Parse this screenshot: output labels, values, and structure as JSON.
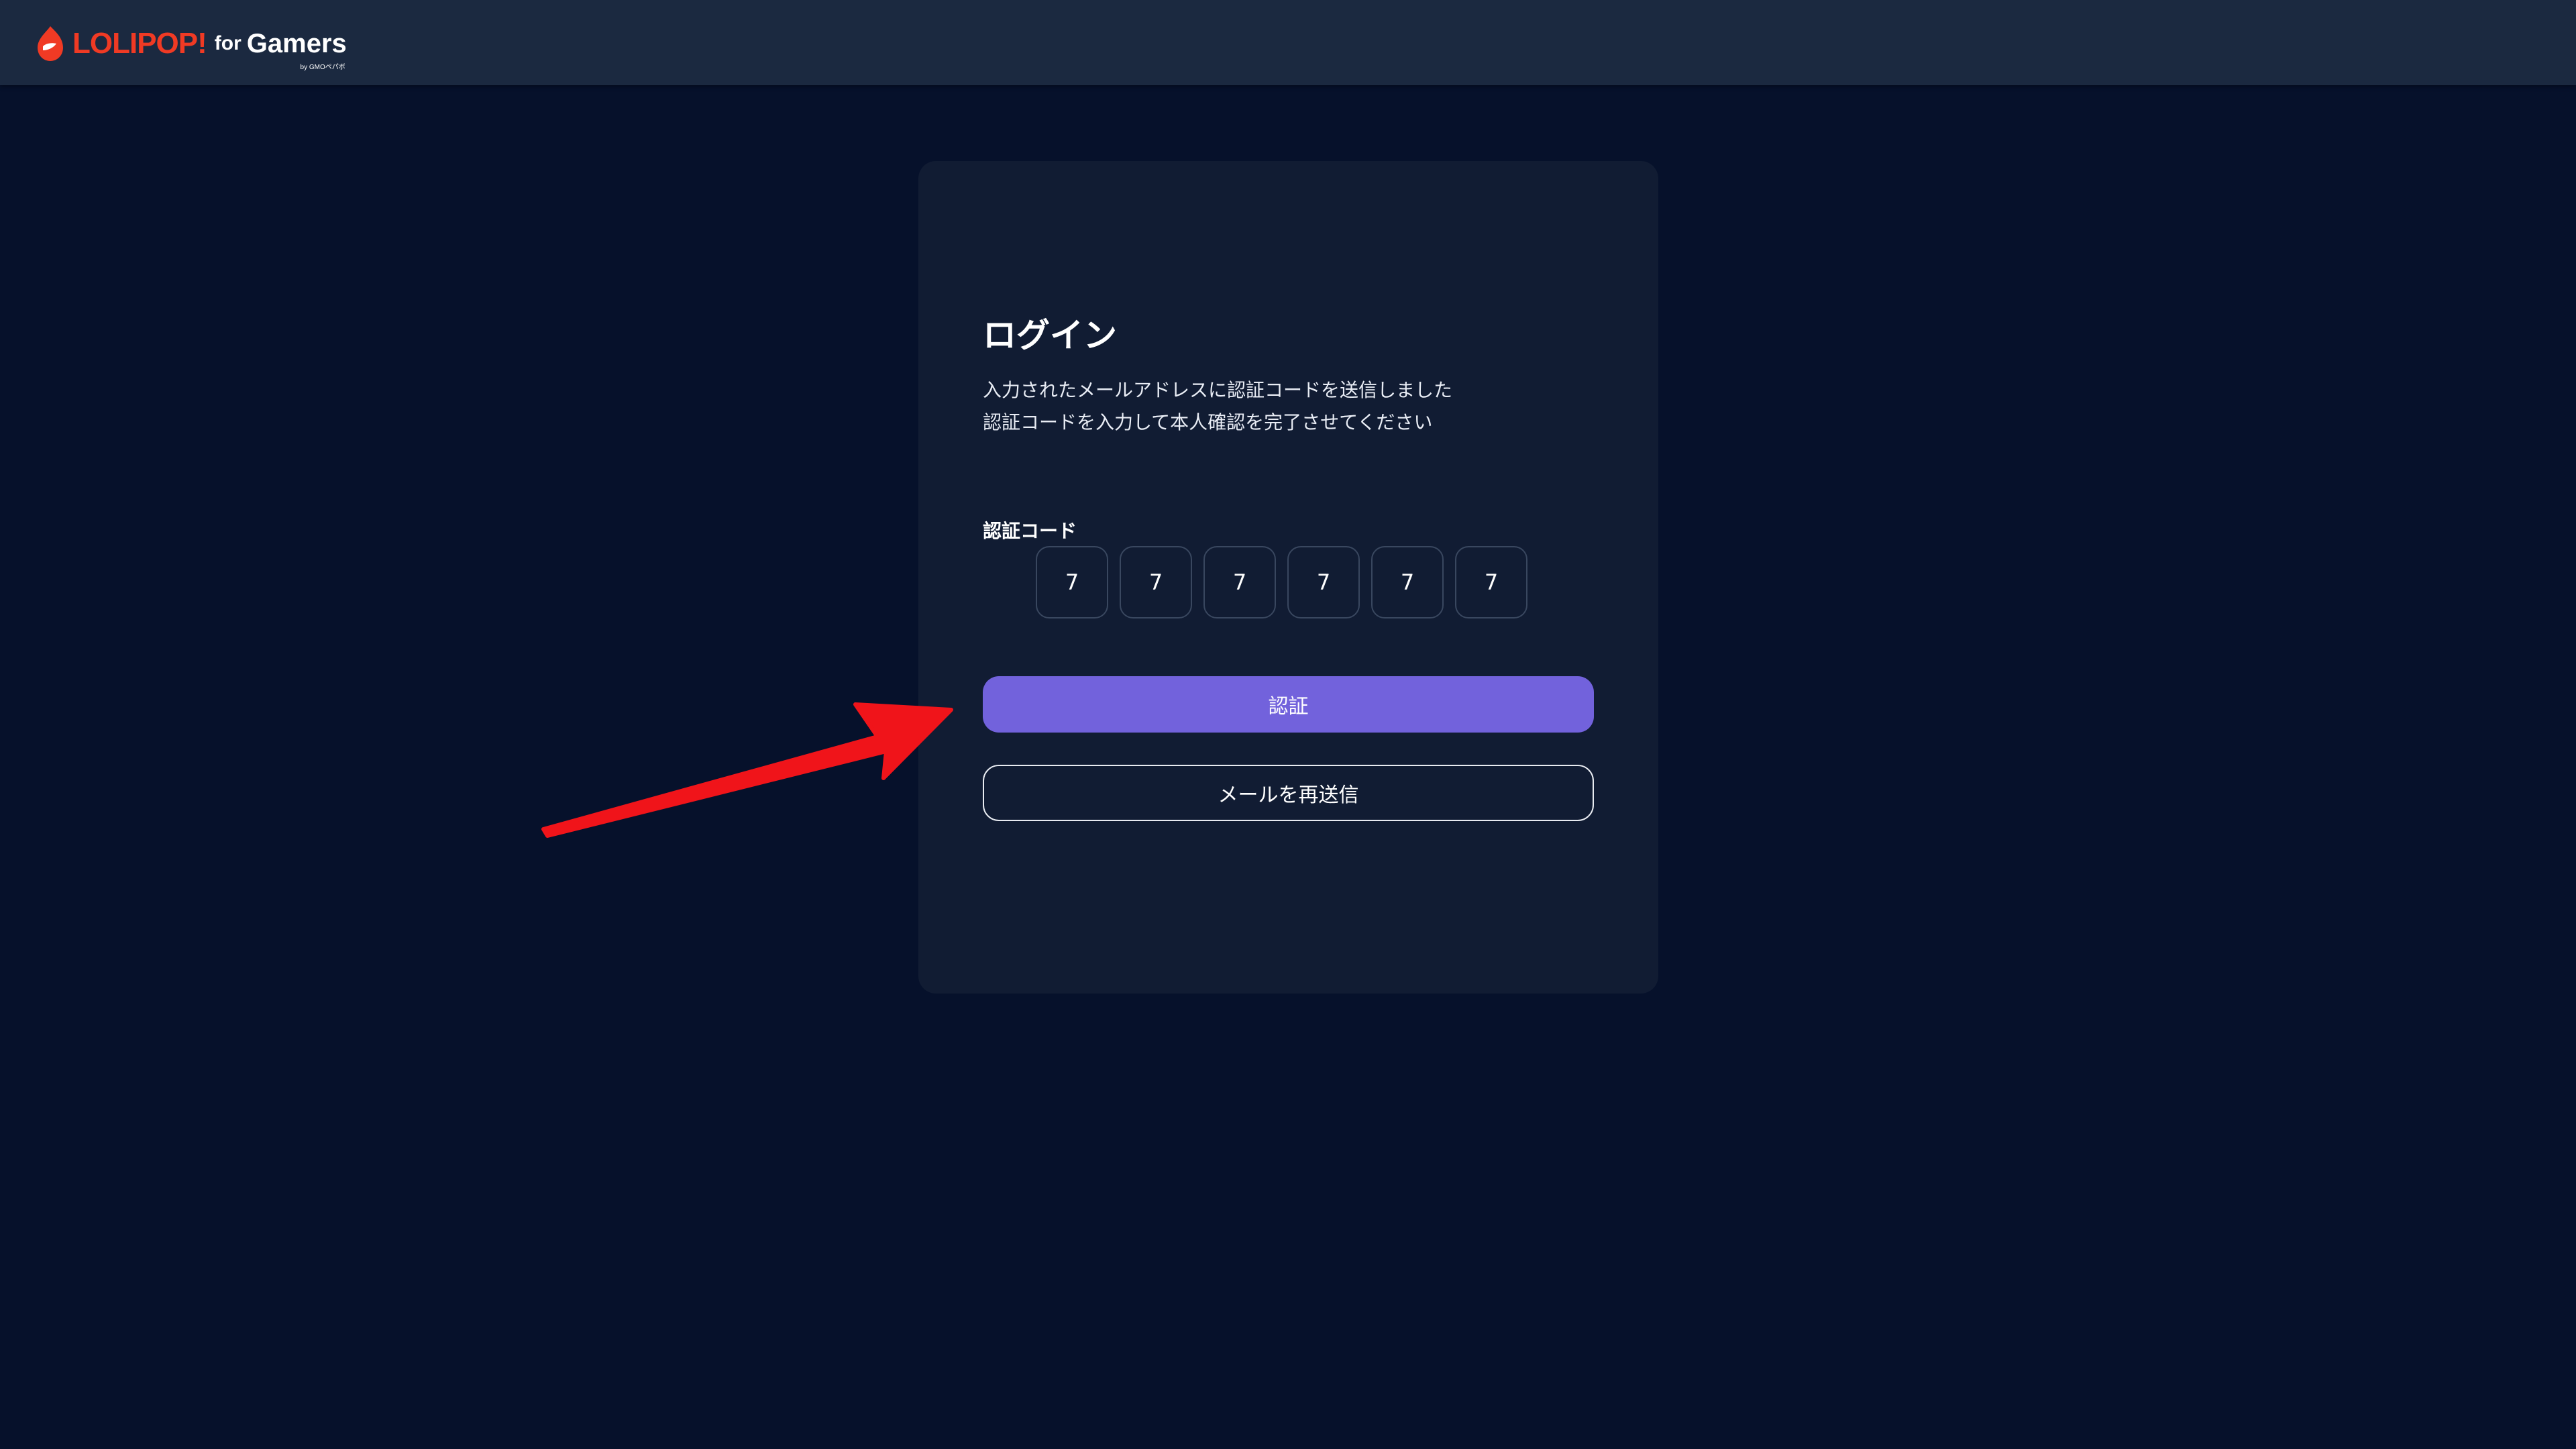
{
  "header": {
    "logo": {
      "brand": "LOLIPOP!",
      "for": "for",
      "product": "Gamers",
      "byline": "by GMOペパボ"
    }
  },
  "login": {
    "title": "ログイン",
    "description_lines": [
      "入力されたメールアドレスに認証コードを送信しました",
      "認証コードを入力して本人確認を完了させてください"
    ],
    "code_label": "認証コード",
    "code_digits": [
      "7",
      "7",
      "7",
      "7",
      "7",
      "7"
    ],
    "verify_button": "認証",
    "resend_button": "メールを再送信"
  },
  "colors": {
    "background": "#06112b",
    "header": "#1b2940",
    "card": "#111c33",
    "accent": "#7262dc",
    "brand": "#f03a24",
    "annotation_arrow": "#f0141a"
  }
}
